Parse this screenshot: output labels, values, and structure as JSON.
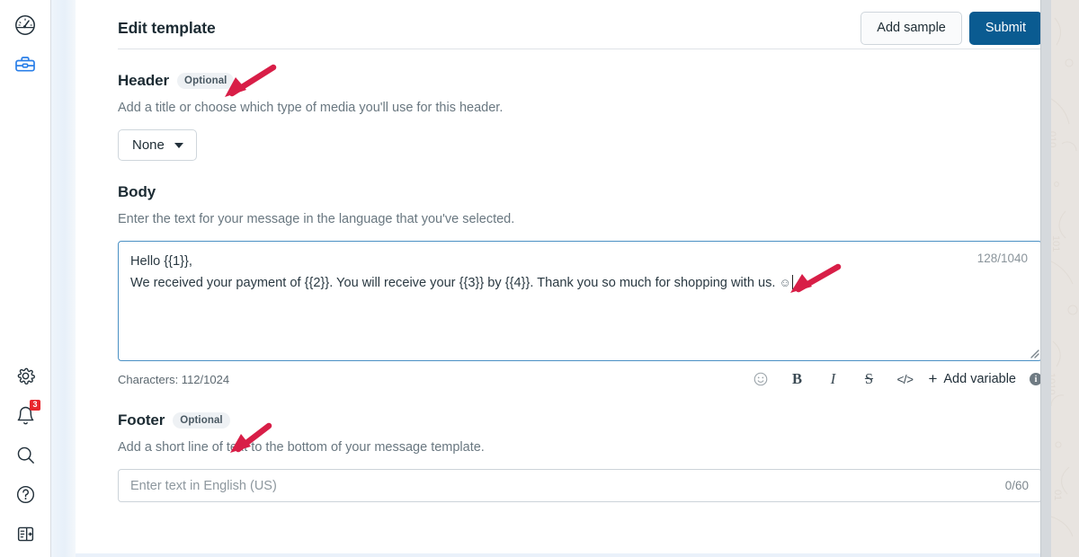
{
  "sidebar": {
    "top_items": [
      {
        "name": "dashboard-gauge-icon",
        "label": "Dashboard"
      },
      {
        "name": "toolbox-icon",
        "label": "Toolbox",
        "active": true
      }
    ],
    "bottom_items": [
      {
        "name": "gear-icon",
        "label": "Settings"
      },
      {
        "name": "bell-icon",
        "label": "Notifications",
        "badge": "3"
      },
      {
        "name": "search-icon",
        "label": "Search"
      },
      {
        "name": "help-icon",
        "label": "Help"
      },
      {
        "name": "panel-toggle-icon",
        "label": "Toggle panel"
      }
    ]
  },
  "header": {
    "title": "Edit template",
    "add_sample_label": "Add sample",
    "submit_label": "Submit"
  },
  "sections": {
    "header_section": {
      "title": "Header",
      "badge": "Optional",
      "description": "Add a title or choose which type of media you'll use for this header.",
      "media_select_value": "None"
    },
    "body_section": {
      "title": "Body",
      "description": "Enter the text for your message in the language that you've selected.",
      "text_line1": "Hello {{1}},",
      "text_line2": "We received your payment of {{2}}. You will receive your {{3}} by {{4}}. Thank you so much for shopping with us. ",
      "emoji": "☺",
      "inline_counter": "128/1040",
      "characters_label": "Characters: 112/1024",
      "toolbar": {
        "emoji_label": "☺",
        "bold_label": "B",
        "italic_label": "I",
        "strike_label": "S",
        "code_label": "</>",
        "add_variable_plus": "+",
        "add_variable_label": "Add variable",
        "info_label": "i"
      }
    },
    "footer_section": {
      "title": "Footer",
      "badge": "Optional",
      "description": "Add a short line of text to the bottom of your message template.",
      "placeholder": "Enter text in English (US)",
      "counter": "0/60"
    }
  },
  "annotations": {
    "arrow_color": "#D81E47",
    "arrows": [
      {
        "name": "arrow-pointing-to-header",
        "target": "header-section"
      },
      {
        "name": "arrow-pointing-to-body-text",
        "target": "body-editor"
      },
      {
        "name": "arrow-pointing-to-footer",
        "target": "footer-section"
      }
    ]
  },
  "colors": {
    "primary": "#0a5b91",
    "accent_blue": "#4a90c4",
    "badge_red": "#e8262d",
    "text_dark": "#1c2b33",
    "text_muted": "#697780"
  }
}
